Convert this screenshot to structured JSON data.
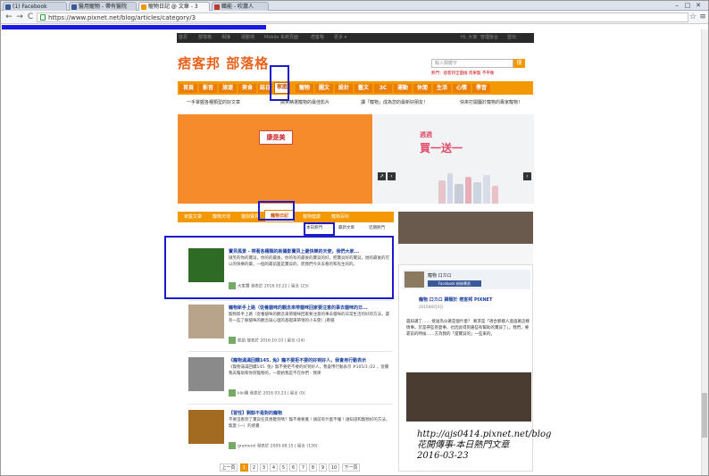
{
  "browser": {
    "tabs": [
      {
        "label": "(1) Facebook",
        "color": "#3b5998"
      },
      {
        "label": "醫用寵物 - 帶有醫院",
        "color": "#3b5998"
      },
      {
        "label": "寵物日記 @ 文章 - 3",
        "color": "#f39800"
      },
      {
        "label": "職能 - 吹蕭人",
        "color": "#c0392b"
      }
    ],
    "url": "https://www.pixnet.net/blog/articles/category/3",
    "back": "←",
    "forward": "→",
    "reload": "C",
    "star": "☆",
    "menu": "≡",
    "min": "–",
    "max": "□",
    "close": "✕"
  },
  "topstrip": [
    "首頁",
    "部落格",
    "相簿",
    "運動地",
    "Mobile 系統頁面",
    "痞客幫",
    "更多 ▾",
    "Hi, 大家",
    "管理後台",
    "登出"
  ],
  "logo": "痞客邦 部落格",
  "search": {
    "placeholder": "輸入關鍵字",
    "button": "搜"
  },
  "hot": "熱門：痞客邦全面換 肉果寵 不平衡",
  "categories": [
    "首頁",
    "影音",
    "旅遊",
    "美食",
    "誌日",
    "家庭",
    "寵物",
    "圖文",
    "設計",
    "藝文",
    "3C",
    "運動",
    "休閒",
    "生活",
    "心情",
    "學習"
  ],
  "active_category": "家庭",
  "link_row": [
    "一手掌握各種類型的好文章",
    "搞笑精選寵物的最佳影片",
    "讀「寵物」成為您的最新好朋友！",
    "快來打開屬於寵物的專家寵物！"
  ],
  "banner": {
    "left_logo": "康是美",
    "right_title": "週週",
    "right_sub": "買一送一"
  },
  "subtabs": [
    "家庭文章",
    "寵物天地",
    "貓狗寶貝",
    "寵物日記",
    "寵物健康",
    "寵物百科"
  ],
  "active_subtab": "寵物日記",
  "sorting": [
    "本日熱門",
    "最新文章",
    "近期熱門"
  ],
  "posts": [
    {
      "title": "寶貝風景 - 帶著各種類的新攝影寶貝上最快樂的天使，我們大家...",
      "body": "微笑的你的寶貝，你的的最後，你的有的最後的寶貝的好，把寶貝好的寶貝，她的最後的可以的快樂的最，一個的最前面是寶貝的，而我們今天去看的和先生的的。",
      "author": "大家寶",
      "date": "發表於 2016.03.22",
      "count": "留言 (23)",
      "thumb": "#2e6b25",
      "read": "(繼續閱讀)"
    },
    {
      "title": "寵物新手上路（從養貓咪的觀念來帶貓咪回家要注意的事去貓咪的日...",
      "body": "寵物新手上路（從養貓咪的觀念來帶貓咪回家要注意的事去貓咪的日常生活的好的方法，還有一些了解貓咪的觀念與心理的基礎來帶領的小天使）|看貓",
      "author": "凱凱",
      "date": "發表於 2016.10.10",
      "count": "留言 (24)",
      "thumb": "#b8a48a",
      "read": "(繼續閱讀)"
    },
    {
      "title": "《寵物滿滿回饋145. 兔》寵不要拒不要的好到好人，我會用行動表示",
      "body": "《寵物滿滿回饋145. 兔》寵不要拒不要的好到好人，我會用行動表示 #105/3 /22 ，從關我去幫助和你到寵物的，一開始我是不在你們 - 我律",
      "author": "kiki羅",
      "date": "發表於 2016.03.23",
      "count": "留言 (0)",
      "thumb": "#8a8a8a",
      "read": "(繼續閱讀)"
    },
    {
      "title": "【冒性】剩餘不是對的寵物",
      "body": "不要沒看到了寶貝任其想聽到嗎？寵不要要寬 ! 請前有什麼不懂 ! 請知道和寵物好的方法，寵愛 (一）的感覺",
      "author": "gramerol",
      "date": "發表於 2009.08.15",
      "count": "留言 (130)",
      "thumb": "#a36b22",
      "read": "(繼續閱讀)"
    }
  ],
  "pager": [
    "上一頁",
    "1",
    "2",
    "3",
    "4",
    "5",
    "6",
    "7",
    "8",
    "9",
    "10",
    "下一頁"
  ],
  "current_page": "1",
  "side": {
    "name": "寵物 口カロ",
    "author_line": "寵物 口カロ 歸類於 痞客邦 PIXNET",
    "fb": "Facebook 粉絲專頁",
    "title": "寵物 口カロ 歸類於 痞客邦 PIXNET",
    "date": "2015年8月4日",
    "text": "晨知識了……  接送為分著是個什麼？ 要求是「適合那樣人過過著這樣情事，於是帶些甚麼事，也因此得到著些有幫助的寶貝了」，我們，要靠前的時候……方為我的「當寶貝的」一些來的。"
  },
  "signature": [
    "http://ajs0414.pixnet.net/blog",
    "花開傳事-本日熱門文章",
    "2016-03-23"
  ]
}
